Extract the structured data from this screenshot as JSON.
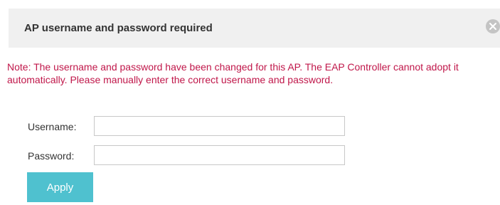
{
  "dialog": {
    "title": "AP username and password required",
    "close_icon": "close-icon"
  },
  "note": "Note: The username and password have been changed for this AP. The EAP Controller cannot adopt it automatically. Please manually enter the correct username and password.",
  "form": {
    "username_label": "Username:",
    "username_value": "",
    "password_label": "Password:",
    "password_value": ""
  },
  "apply_label": "Apply",
  "colors": {
    "note": "#c0174a",
    "accent": "#4fc1cf",
    "header_bg": "#f0f0f0"
  }
}
